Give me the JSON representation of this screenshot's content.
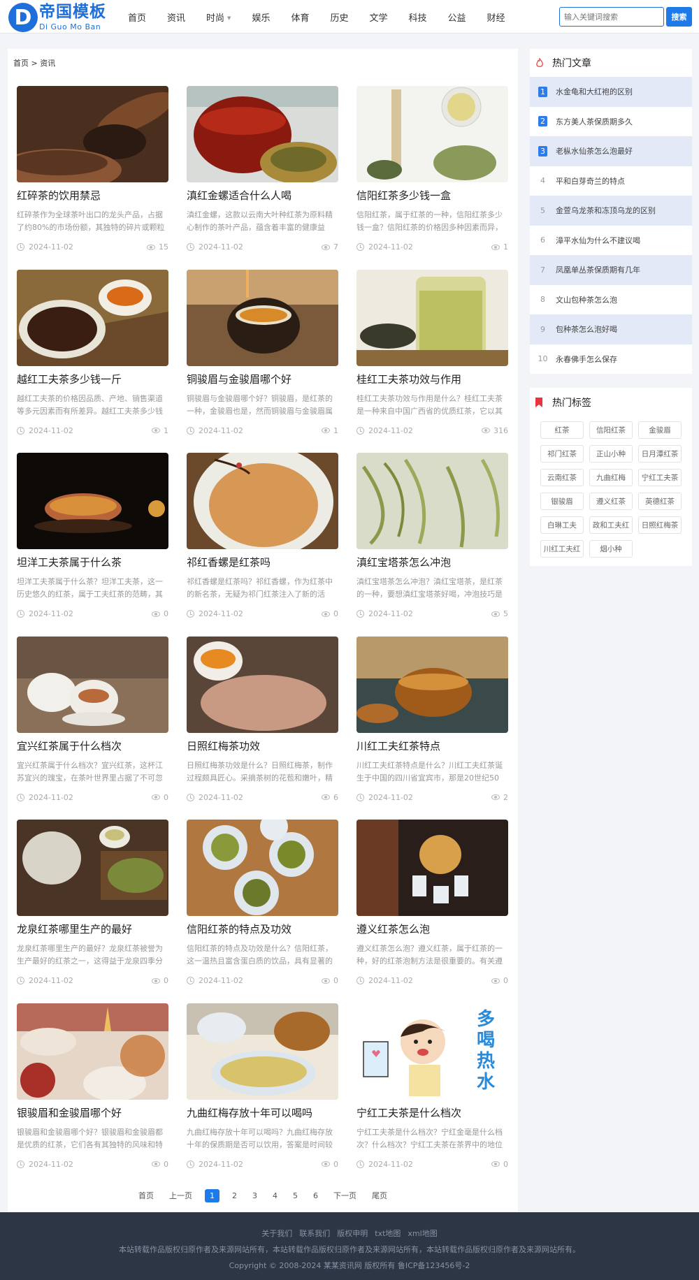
{
  "header": {
    "logo_letter": "D",
    "logo_cn": "帝国模板",
    "logo_en": "Di Guo Mo Ban",
    "nav": [
      "首页",
      "资讯",
      "时尚",
      "娱乐",
      "体育",
      "历史",
      "文学",
      "科技",
      "公益",
      "财经"
    ],
    "search_placeholder": "输入关键词搜索",
    "search_button": "搜索"
  },
  "breadcrumb": "首页 > 资讯",
  "articles": [
    {
      "title": "红碎茶的饮用禁忌",
      "excerpt": "红碎茶作为全球茶叶出口的龙头产品，占据了约80%的市场份额，其独特的碎片或颗粒",
      "date": "2024-11-02",
      "views": "15",
      "img": "brown-dark"
    },
    {
      "title": "滇红金螺适合什么人喝",
      "excerpt": "滇红金螺，这款以云南大叶种红茶为原料精心制作的茶叶产品，蕴含着丰富的健康益",
      "date": "2024-11-02",
      "views": "7",
      "img": "red-jar"
    },
    {
      "title": "信阳红茶多少钱一盒",
      "excerpt": "信阳红茶，属于红茶的一种，信阳红茶多少钱一盒？信阳红茶的价格因多种因素而异，",
      "date": "2024-11-02",
      "views": "1",
      "img": "white-green"
    },
    {
      "title": "越红工夫茶多少钱一斤",
      "excerpt": "越红工夫茶的价格因品质、产地、销售渠道等多元因素而有所差异。越红工夫茶多少钱",
      "date": "2024-11-02",
      "views": "1",
      "img": "bamboo-dark"
    },
    {
      "title": "铜骏眉与金骏眉哪个好",
      "excerpt": "铜骏眉与金骏眉哪个好？铜骏眉，是红茶的一种，金骏眉也是，然而铜骏眉与金骏眉属",
      "date": "2024-11-02",
      "views": "1",
      "img": "amber-pour"
    },
    {
      "title": "桂红工夫茶功效与作用",
      "excerpt": "桂红工夫茶功效与作用是什么？桂红工夫茶是一种来自中国广西省的优质红茶，它以其",
      "date": "2024-11-02",
      "views": "316",
      "img": "glass-green"
    },
    {
      "title": "坦洋工夫茶属于什么茶",
      "excerpt": "坦洋工夫茶属于什么茶？坦洋工夫茶，这一历史悠久的红茶，属于工夫红茶的范畴，其",
      "date": "2024-11-02",
      "views": "0",
      "img": "black-cup"
    },
    {
      "title": "祁红香螺是红茶吗",
      "excerpt": "祁红香螺是红茶吗？祁红香螺，作为红茶中的新名茶，无疑为祁门红茶注入了新的活",
      "date": "2024-11-02",
      "views": "0",
      "img": "bowl-orange"
    },
    {
      "title": "滇红宝塔茶怎么冲泡",
      "excerpt": "滇红宝塔茶怎么冲泡？滇红宝塔茶，是红茶的一种，要想滇红宝塔茶好喝，冲泡技巧是",
      "date": "2024-11-02",
      "views": "5",
      "img": "green-leaf"
    },
    {
      "title": "宜兴红茶属于什么档次",
      "excerpt": "宜兴红茶属于什么档次？宜兴红茶，这杯江苏宜兴的瑰宝，在茶叶世界里占据了不可忽",
      "date": "2024-11-02",
      "views": "0",
      "img": "wood-white"
    },
    {
      "title": "日照红梅茶功效",
      "excerpt": "日照红梅茶功效是什么？日照红梅茶，制作过程颇具匠心。采摘茶树的花苞和嫩叶，精",
      "date": "2024-11-02",
      "views": "6",
      "img": "hand-cup"
    },
    {
      "title": "川红工夫红茶特点",
      "excerpt": "川红工夫红茶特点是什么？川红工夫红茶诞生于中国的四川省宜宾市，那是20世纪50",
      "date": "2024-11-02",
      "views": "2",
      "img": "glass-amber"
    },
    {
      "title": "龙泉红茶哪里生产的最好",
      "excerpt": "龙泉红茶哪里生产的最好？龙泉红茶被誉为生产最好的红茶之一，这得益于龙泉四季分",
      "date": "2024-11-02",
      "views": "0",
      "img": "pot-green"
    },
    {
      "title": "信阳红茶的特点及功效",
      "excerpt": "信阳红茶的特点及功效是什么？信阳红茶，这一温热且富含蛋白质的饮品，具有显著的",
      "date": "2024-11-02",
      "views": "0",
      "img": "cups-wicker"
    },
    {
      "title": "遵义红茶怎么泡",
      "excerpt": "遵义红茶怎么泡？遵义红茶，属于红茶的一种，好的红茶泡制方法是很重要的。有关遵",
      "date": "2024-11-02",
      "views": "0",
      "img": "pour-dark"
    },
    {
      "title": "银骏眉和金骏眉哪个好",
      "excerpt": "银骏眉和金骏眉哪个好？银骏眉和金骏眉都是优质的红茶，它们各有其独特的风味和特",
      "date": "2024-11-02",
      "views": "0",
      "img": "set-table"
    },
    {
      "title": "九曲红梅存放十年可以喝吗",
      "excerpt": "九曲红梅存放十年可以喝吗？九曲红梅存放十年的保质期是否可以饮用，答案是时间较",
      "date": "2024-11-02",
      "views": "0",
      "img": "bowl-yellow"
    },
    {
      "title": "宁红工夫茶是什么档次",
      "excerpt": "宁红工夫茶是什么档次？宁红金毫是什么档次？什么档次？宁红工夫茶在茶界中的地位",
      "date": "2024-11-02",
      "views": "0",
      "img": "cartoon"
    }
  ],
  "cartoon_text": "多喝热水",
  "pager": [
    "首页",
    "上一页",
    "1",
    "2",
    "3",
    "4",
    "5",
    "6",
    "下一页",
    "尾页"
  ],
  "pager_active": "1",
  "hot_articles": {
    "title": "热门文章",
    "items": [
      {
        "num": "1",
        "text": "水金龟和大红袍的区别"
      },
      {
        "num": "2",
        "text": "东方美人茶保质期多久"
      },
      {
        "num": "3",
        "text": "老枞水仙茶怎么泡最好"
      },
      {
        "num": "4",
        "text": "平和白芽奇兰的特点"
      },
      {
        "num": "5",
        "text": "金萱乌龙茶和冻顶乌龙的区别"
      },
      {
        "num": "6",
        "text": "漳平水仙为什么不建议喝"
      },
      {
        "num": "7",
        "text": "凤凰单丛茶保质期有几年"
      },
      {
        "num": "8",
        "text": "文山包种茶怎么泡"
      },
      {
        "num": "9",
        "text": "包种茶怎么泡好喝"
      },
      {
        "num": "10",
        "text": "永春佛手怎么保存"
      }
    ]
  },
  "hot_tags": {
    "title": "热门标签",
    "tags": [
      "红茶",
      "信阳红茶",
      "金骏眉",
      "祁门红茶",
      "正山小种",
      "日月潭红茶",
      "云南红茶",
      "九曲红梅",
      "宁红工夫茶",
      "银骏眉",
      "遵义红茶",
      "英德红茶",
      "白琳工夫",
      "政和工夫红",
      "日照红梅茶",
      "川红工夫红",
      "烟小种"
    ]
  },
  "footer": {
    "links": [
      "关于我们",
      "联系我们",
      "版权申明",
      "txt地图",
      "xml地图"
    ],
    "notice": "本站转载作品版权归原作者及来源网站所有，本站转载作品版权归原作者及来源网站所有，本站转载作品版权归原作者及来源网站所有。",
    "copyright": "Copyright © 2008-2024 某某资讯网 版权所有 鲁ICP备123456号-2"
  },
  "colors": {
    "accent": "#1e7ae8",
    "footer_bg": "#2c3645",
    "highlight_row": "#e4e9f7"
  }
}
